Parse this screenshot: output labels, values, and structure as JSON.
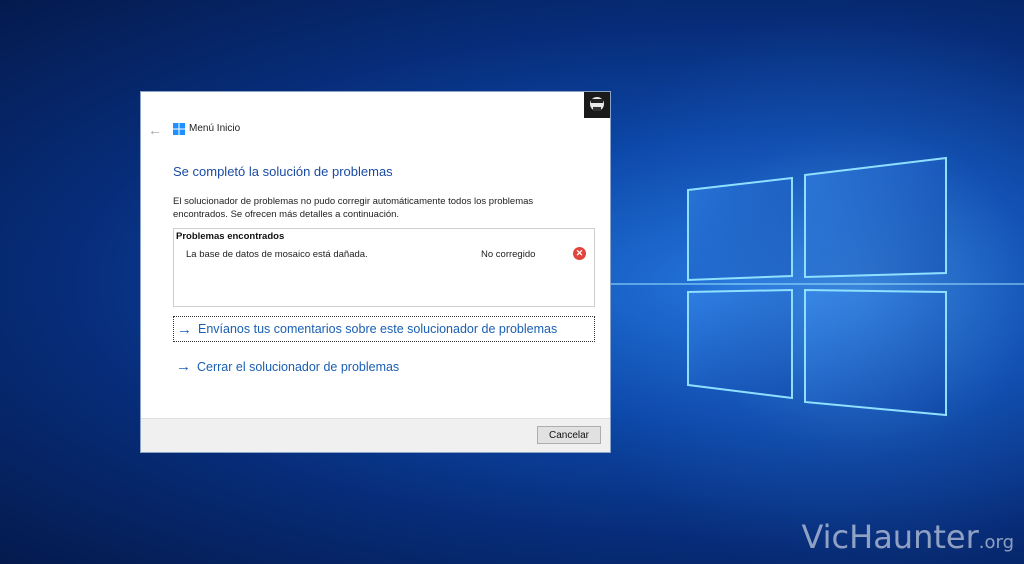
{
  "dialog": {
    "app_title": "Menú Inicio",
    "heading": "Se completó la solución de problemas",
    "description": "El solucionador de problemas no pudo corregir automáticamente todos los problemas encontrados. Se ofrecen más detalles a continuación.",
    "problems": {
      "header": "Problemas encontrados",
      "rows": [
        {
          "name": "La base de datos de mosaico está dañada.",
          "status": "No corregido",
          "icon": "error-icon"
        }
      ]
    },
    "links": {
      "feedback": "Envíanos tus comentarios sobre este solucionador de problemas",
      "close": "Cerrar el solucionador de problemas"
    },
    "footer": {
      "cancel_label": "Cancelar"
    }
  },
  "watermark": {
    "text": "VicHaunter",
    "tld": ".org"
  },
  "colors": {
    "heading": "#1a4ba3",
    "link": "#1a5fb4",
    "error": "#e0443a",
    "desktop": "#0c47a8"
  }
}
